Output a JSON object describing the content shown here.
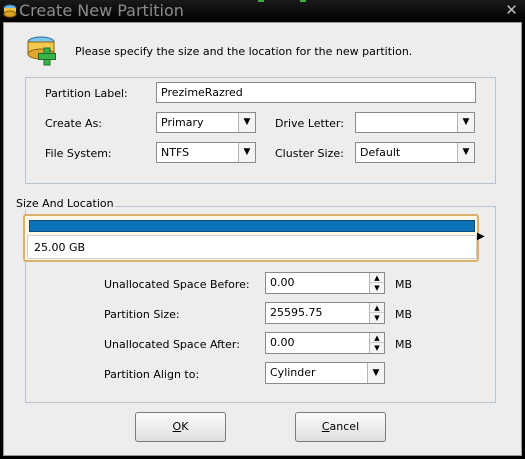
{
  "window": {
    "title": "Create New Partition",
    "close_glyph": "✕"
  },
  "header": {
    "text": "Please specify the size and the location for the new partition.",
    "icon": "partition-add-icon"
  },
  "form": {
    "label_label": "Partition Label:",
    "label_value": "PrezimeRazred",
    "create_as_label": "Create As:",
    "create_as_value": "Primary",
    "drive_letter_label": "Drive Letter:",
    "drive_letter_value": "",
    "file_system_label": "File System:",
    "file_system_value": "NTFS",
    "cluster_size_label": "Cluster Size:",
    "cluster_size_value": "Default"
  },
  "size_location": {
    "title": "Size And Location",
    "partition_size_text": "25.00 GB",
    "bar_color": "#0a72b8",
    "unalloc_before_label": "Unallocated Space Before:",
    "unalloc_before_value": "0.00",
    "partition_size_label": "Partition Size:",
    "partition_size_value": "25595.75",
    "unalloc_after_label": "Unallocated Space After:",
    "unalloc_after_value": "0.00",
    "unit": "MB",
    "align_label": "Partition Align to:",
    "align_value": "Cylinder"
  },
  "buttons": {
    "ok_hotkey": "O",
    "ok_rest": "K",
    "cancel_hotkey": "C",
    "cancel_rest": "ancel"
  }
}
